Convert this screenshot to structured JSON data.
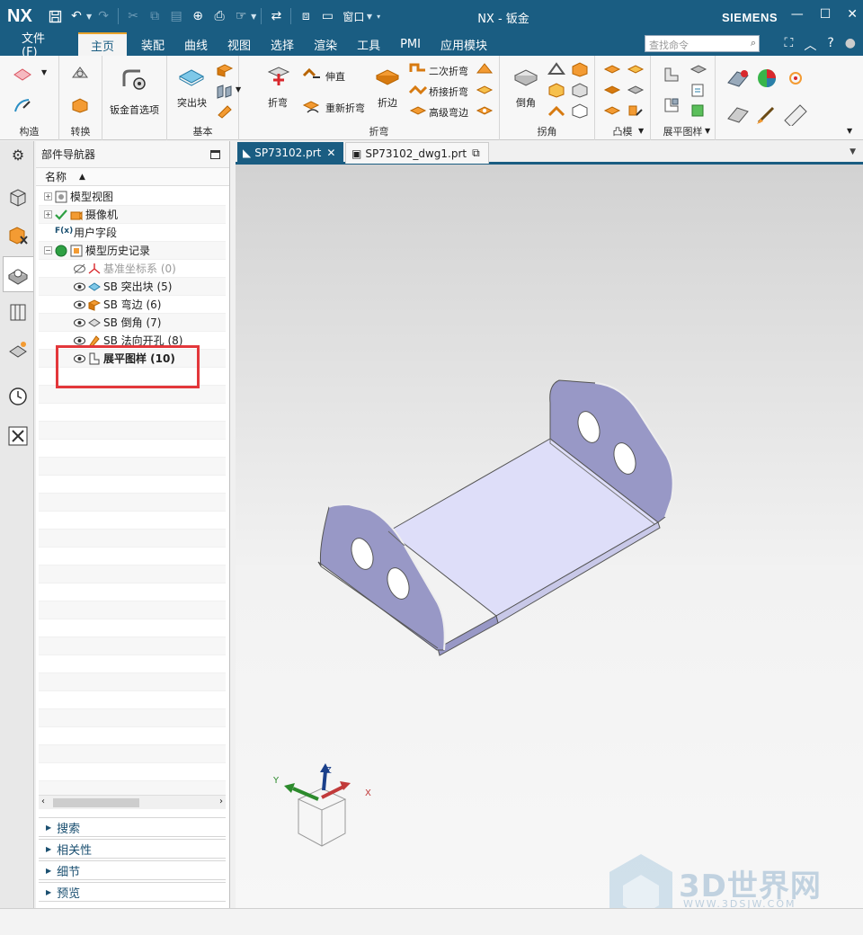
{
  "app": {
    "logo": "NX",
    "title": "NX - 钣金",
    "brand": "SIEMENS",
    "window_menu": "窗口"
  },
  "menu": {
    "items": [
      "文件(F)",
      "主页",
      "装配",
      "曲线",
      "视图",
      "选择",
      "渲染",
      "工具",
      "PMI",
      "应用模块"
    ],
    "active": "主页",
    "command_search_placeholder": "查找命令"
  },
  "ribbon": {
    "groups": [
      {
        "label": "构造"
      },
      {
        "label": "转换"
      },
      {
        "label": "基本"
      },
      {
        "label": "折弯"
      },
      {
        "label": "拐角"
      },
      {
        "label": "凸模"
      },
      {
        "label": "展平图样"
      }
    ],
    "buttons": {
      "sheetmetal_prefs": "钣金首选项",
      "tab": "突出块",
      "bend": "折弯",
      "unbend": "伸直",
      "rebend": "重新折弯",
      "flange": "折边",
      "two_step_bend": "二次折弯",
      "bridge_bend": "桥接折弯",
      "advanced_flange": "高级弯边",
      "chamfer": "倒角"
    }
  },
  "navigator": {
    "title": "部件导航器",
    "column": "名称",
    "rows": [
      {
        "label": "模型视图"
      },
      {
        "label": "摄像机"
      },
      {
        "label": "用户字段"
      },
      {
        "label": "模型历史记录"
      },
      {
        "label": "基准坐标系 (0)"
      },
      {
        "label": "SB 突出块 (5)"
      },
      {
        "label": "SB 弯边 (6)"
      },
      {
        "label": "SB 倒角 (7)"
      },
      {
        "label": "SB 法向开孔 (8)"
      },
      {
        "label": "展平图样 (10)"
      }
    ],
    "panels": [
      "搜索",
      "相关性",
      "细节",
      "预览"
    ]
  },
  "tabs": [
    {
      "label": "SP73102.prt"
    },
    {
      "label": "SP73102_dwg1.prt"
    }
  ],
  "triad": {
    "x": "X",
    "y": "Y",
    "z": "Z"
  },
  "watermark": {
    "text": "3D世界网",
    "sub": "WWW.3DSJW.COM"
  },
  "colors": {
    "titlebar": "#1a5d82",
    "accent": "#e9a32c",
    "model_face": "#d8d8f8",
    "model_side": "#9797c4",
    "highlight": "#e3373b"
  }
}
